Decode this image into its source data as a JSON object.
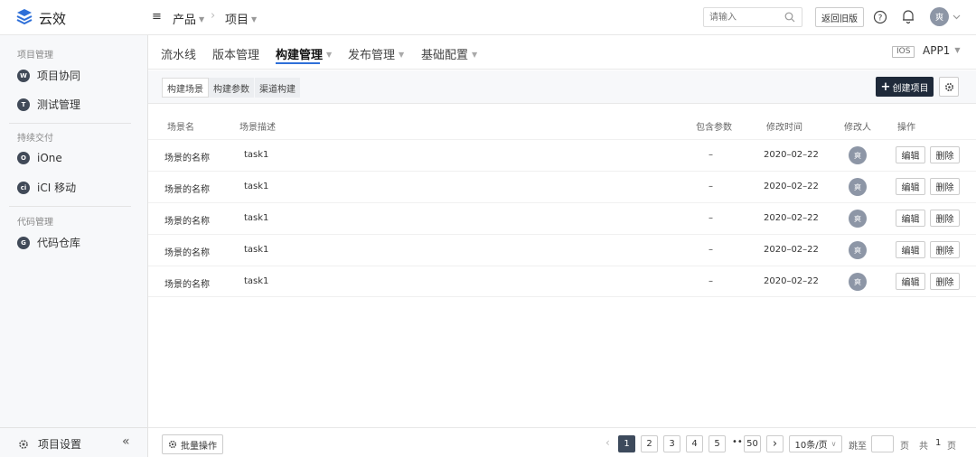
{
  "brand": {
    "name": "云效"
  },
  "breadcrumb": {
    "product": "产品",
    "project": "项目"
  },
  "header": {
    "search_placeholder": "请输入",
    "back_label": "返回旧版",
    "user_avatar": "爽"
  },
  "sidebar": {
    "groups": [
      {
        "label": "项目管理",
        "items": [
          {
            "label": "项目协同",
            "icon": "W"
          },
          {
            "label": "测试管理",
            "icon": "T"
          }
        ]
      },
      {
        "label": "持续交付",
        "items": [
          {
            "label": "iOne",
            "icon": "O"
          },
          {
            "label": "iCI 移动",
            "icon": "ci"
          }
        ]
      },
      {
        "label": "代码管理",
        "items": [
          {
            "label": "代码仓库",
            "icon": "G"
          }
        ]
      }
    ],
    "settings_label": "项目设置",
    "collapse_label": "«"
  },
  "tabs": [
    {
      "label": "流水线"
    },
    {
      "label": "版本管理"
    },
    {
      "label": "构建管理"
    },
    {
      "label": "发布管理"
    },
    {
      "label": "基础配置"
    }
  ],
  "app_selector": {
    "platform": "IOS",
    "app": "APP1"
  },
  "toolbar": {
    "segments": [
      "构建场景",
      "构建参数",
      "渠道构建"
    ],
    "create_label": "创建项目"
  },
  "table": {
    "columns": [
      "场景名",
      "场景描述",
      "包含参数",
      "修改时间",
      "修改人",
      "操作"
    ],
    "rows": [
      {
        "name": "场景的名称",
        "desc": "task1",
        "params": "–",
        "time": "2020–02–22",
        "user": "爽"
      },
      {
        "name": "场景的名称",
        "desc": "task1",
        "params": "–",
        "time": "2020–02–22",
        "user": "爽"
      },
      {
        "name": "场景的名称",
        "desc": "task1",
        "params": "–",
        "time": "2020–02–22",
        "user": "爽"
      },
      {
        "name": "场景的名称",
        "desc": "task1",
        "params": "–",
        "time": "2020–02–22",
        "user": "爽"
      },
      {
        "name": "场景的名称",
        "desc": "task1",
        "params": "–",
        "time": "2020–02–22",
        "user": "爽"
      }
    ],
    "edit_label": "编辑",
    "delete_label": "删除"
  },
  "footer": {
    "batch_label": "批量操作",
    "pages": [
      "1",
      "2",
      "3",
      "4",
      "5"
    ],
    "ellipsis": "•••",
    "last_page": "50",
    "prev": "‹",
    "next": "›",
    "page_size": "10条/页",
    "jump_label": "跳至",
    "page_unit": "页",
    "total_prefix": "共",
    "total_pages": "1",
    "total_suffix": "页"
  }
}
